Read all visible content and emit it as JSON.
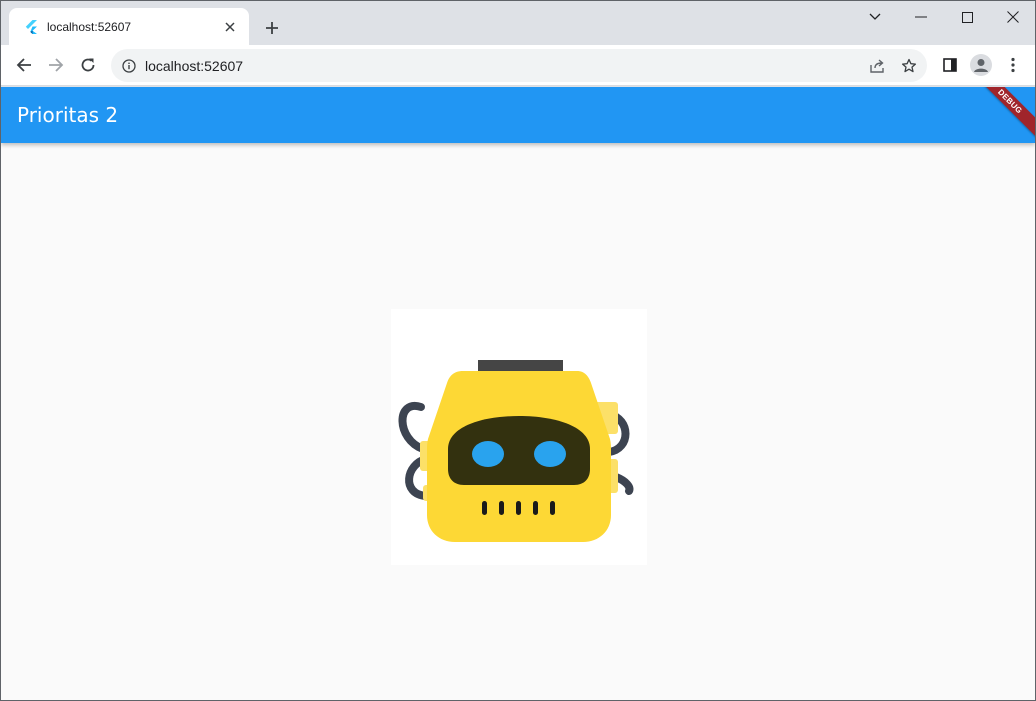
{
  "browser": {
    "tab": {
      "title": "localhost:52607",
      "favicon": "flutter-icon"
    },
    "omnibox": {
      "url": "localhost:52607",
      "security_icon": "info-icon"
    },
    "controls": {
      "back": "back-arrow-icon",
      "forward": "forward-arrow-icon",
      "reload": "reload-icon",
      "share": "share-icon",
      "bookmark": "star-icon",
      "side_panel": "side-panel-icon",
      "profile": "profile-avatar-icon",
      "menu": "kebab-menu-icon"
    }
  },
  "app": {
    "appbar": {
      "title": "Prioritas 2",
      "color": "#2196f3"
    },
    "debug_banner": "DEBUG",
    "body_background": "#fafafa",
    "image": {
      "subject": "robot-head-icon",
      "accent": "#fdd835",
      "eye_color": "#29a3ee"
    }
  }
}
